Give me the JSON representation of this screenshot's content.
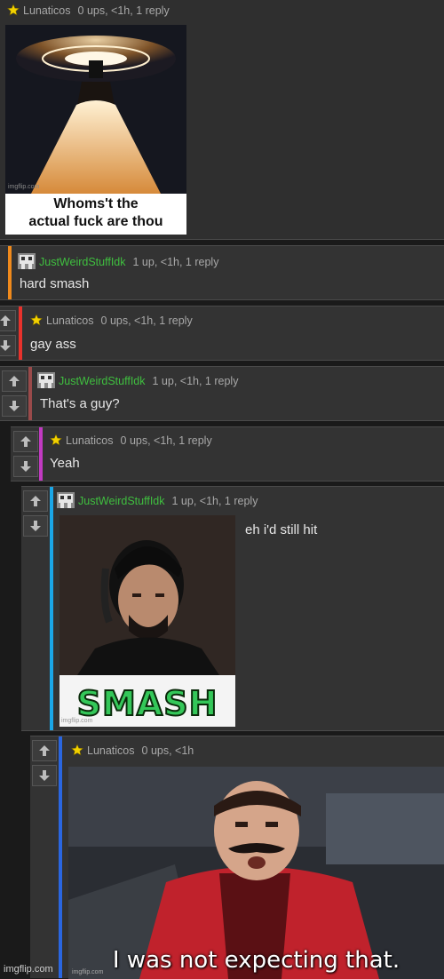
{
  "post": {
    "user": "Lunaticos",
    "meta": "0 ups, <1h, 1 reply",
    "image_caption_line1": "Whoms't the",
    "image_caption_line2": "actual fuck are thou",
    "image_credit": "imgflip.com"
  },
  "comments": [
    {
      "user": "JustWeirdStuffIdk",
      "meta": "1 up, <1h, 1 reply",
      "text": "hard smash",
      "bar_color": "#f08a1c"
    },
    {
      "user": "Lunaticos",
      "meta": "0 ups, <1h, 1 reply",
      "text": "gay ass",
      "bar_color": "#e8322c"
    },
    {
      "user": "JustWeirdStuffIdk",
      "meta": "1 up, <1h, 1 reply",
      "text": "That's a guy?",
      "bar_color": "#9a4a4a"
    },
    {
      "user": "Lunaticos",
      "meta": "0 ups, <1h, 1 reply",
      "text": "Yeah",
      "bar_color": "#c23ac2"
    },
    {
      "user": "JustWeirdStuffIdk",
      "meta": "1 up, <1h, 1 reply",
      "text": "eh i'd still hit",
      "image_caption": "SMASH",
      "image_credit": "imgflip.com",
      "bar_color": "#1aa7e8"
    },
    {
      "user": "Lunaticos",
      "meta": "0 ups, <1h",
      "image_caption": "I was not expecting that.",
      "image_credit": "imgflip.com",
      "bar_color": "#2a66e0"
    }
  ],
  "footer": {
    "watermark": "imgflip.com"
  },
  "icons": {
    "star": "star-icon",
    "avatar": "pixel-avatar-icon",
    "up": "arrow-up-icon",
    "down": "arrow-down-icon"
  }
}
